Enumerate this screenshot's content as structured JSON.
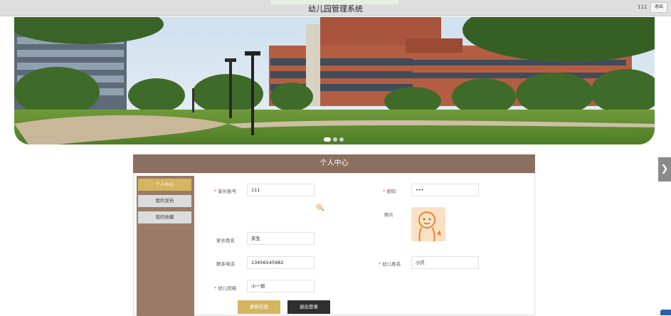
{
  "header": {
    "title": "幼儿园管理系统",
    "username": "111",
    "logout_label": "退出"
  },
  "carousel": {
    "slide_count": 3,
    "active_index": 0
  },
  "profile": {
    "title": "个人中心",
    "menu": [
      {
        "label": "个人中心",
        "active": true
      },
      {
        "label": "我的发布",
        "active": false
      },
      {
        "label": "我的收藏",
        "active": false
      }
    ],
    "fields": {
      "account": {
        "label": "家长账号",
        "value": "111",
        "required": true
      },
      "password": {
        "label": "密码",
        "value": "•••",
        "required": true
      },
      "photo": {
        "label": "照片"
      },
      "parent_name": {
        "label": "家长姓名",
        "value": "买生",
        "required": false
      },
      "phone": {
        "label": "联系电话",
        "value": "13456545982",
        "required": false
      },
      "child_name": {
        "label": "幼儿姓名",
        "value": "小贝",
        "required": true
      },
      "class": {
        "label": "幼儿班级",
        "value": "小一班",
        "required": true
      }
    },
    "buttons": {
      "update": "更新信息",
      "exit": "退出登录"
    }
  },
  "colors": {
    "accent_gold": "#d4b560",
    "header_brown": "#8b7060",
    "sidebar_brown": "#9a7b68",
    "dark_button": "#2f2f2f"
  }
}
